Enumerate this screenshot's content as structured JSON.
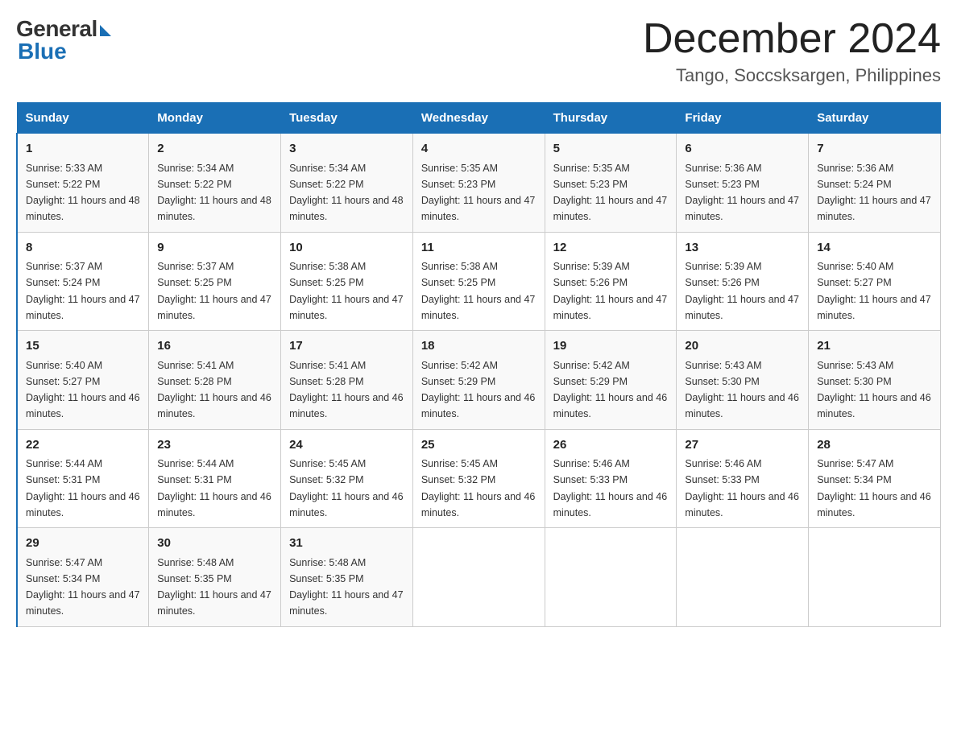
{
  "header": {
    "logo_general": "General",
    "logo_blue": "Blue",
    "month_title": "December 2024",
    "location": "Tango, Soccsksargen, Philippines"
  },
  "days_of_week": [
    "Sunday",
    "Monday",
    "Tuesday",
    "Wednesday",
    "Thursday",
    "Friday",
    "Saturday"
  ],
  "weeks": [
    [
      {
        "day": "1",
        "sunrise": "5:33 AM",
        "sunset": "5:22 PM",
        "daylight": "11 hours and 48 minutes."
      },
      {
        "day": "2",
        "sunrise": "5:34 AM",
        "sunset": "5:22 PM",
        "daylight": "11 hours and 48 minutes."
      },
      {
        "day": "3",
        "sunrise": "5:34 AM",
        "sunset": "5:22 PM",
        "daylight": "11 hours and 48 minutes."
      },
      {
        "day": "4",
        "sunrise": "5:35 AM",
        "sunset": "5:23 PM",
        "daylight": "11 hours and 47 minutes."
      },
      {
        "day": "5",
        "sunrise": "5:35 AM",
        "sunset": "5:23 PM",
        "daylight": "11 hours and 47 minutes."
      },
      {
        "day": "6",
        "sunrise": "5:36 AM",
        "sunset": "5:23 PM",
        "daylight": "11 hours and 47 minutes."
      },
      {
        "day": "7",
        "sunrise": "5:36 AM",
        "sunset": "5:24 PM",
        "daylight": "11 hours and 47 minutes."
      }
    ],
    [
      {
        "day": "8",
        "sunrise": "5:37 AM",
        "sunset": "5:24 PM",
        "daylight": "11 hours and 47 minutes."
      },
      {
        "day": "9",
        "sunrise": "5:37 AM",
        "sunset": "5:25 PM",
        "daylight": "11 hours and 47 minutes."
      },
      {
        "day": "10",
        "sunrise": "5:38 AM",
        "sunset": "5:25 PM",
        "daylight": "11 hours and 47 minutes."
      },
      {
        "day": "11",
        "sunrise": "5:38 AM",
        "sunset": "5:25 PM",
        "daylight": "11 hours and 47 minutes."
      },
      {
        "day": "12",
        "sunrise": "5:39 AM",
        "sunset": "5:26 PM",
        "daylight": "11 hours and 47 minutes."
      },
      {
        "day": "13",
        "sunrise": "5:39 AM",
        "sunset": "5:26 PM",
        "daylight": "11 hours and 47 minutes."
      },
      {
        "day": "14",
        "sunrise": "5:40 AM",
        "sunset": "5:27 PM",
        "daylight": "11 hours and 47 minutes."
      }
    ],
    [
      {
        "day": "15",
        "sunrise": "5:40 AM",
        "sunset": "5:27 PM",
        "daylight": "11 hours and 46 minutes."
      },
      {
        "day": "16",
        "sunrise": "5:41 AM",
        "sunset": "5:28 PM",
        "daylight": "11 hours and 46 minutes."
      },
      {
        "day": "17",
        "sunrise": "5:41 AM",
        "sunset": "5:28 PM",
        "daylight": "11 hours and 46 minutes."
      },
      {
        "day": "18",
        "sunrise": "5:42 AM",
        "sunset": "5:29 PM",
        "daylight": "11 hours and 46 minutes."
      },
      {
        "day": "19",
        "sunrise": "5:42 AM",
        "sunset": "5:29 PM",
        "daylight": "11 hours and 46 minutes."
      },
      {
        "day": "20",
        "sunrise": "5:43 AM",
        "sunset": "5:30 PM",
        "daylight": "11 hours and 46 minutes."
      },
      {
        "day": "21",
        "sunrise": "5:43 AM",
        "sunset": "5:30 PM",
        "daylight": "11 hours and 46 minutes."
      }
    ],
    [
      {
        "day": "22",
        "sunrise": "5:44 AM",
        "sunset": "5:31 PM",
        "daylight": "11 hours and 46 minutes."
      },
      {
        "day": "23",
        "sunrise": "5:44 AM",
        "sunset": "5:31 PM",
        "daylight": "11 hours and 46 minutes."
      },
      {
        "day": "24",
        "sunrise": "5:45 AM",
        "sunset": "5:32 PM",
        "daylight": "11 hours and 46 minutes."
      },
      {
        "day": "25",
        "sunrise": "5:45 AM",
        "sunset": "5:32 PM",
        "daylight": "11 hours and 46 minutes."
      },
      {
        "day": "26",
        "sunrise": "5:46 AM",
        "sunset": "5:33 PM",
        "daylight": "11 hours and 46 minutes."
      },
      {
        "day": "27",
        "sunrise": "5:46 AM",
        "sunset": "5:33 PM",
        "daylight": "11 hours and 46 minutes."
      },
      {
        "day": "28",
        "sunrise": "5:47 AM",
        "sunset": "5:34 PM",
        "daylight": "11 hours and 46 minutes."
      }
    ],
    [
      {
        "day": "29",
        "sunrise": "5:47 AM",
        "sunset": "5:34 PM",
        "daylight": "11 hours and 47 minutes."
      },
      {
        "day": "30",
        "sunrise": "5:48 AM",
        "sunset": "5:35 PM",
        "daylight": "11 hours and 47 minutes."
      },
      {
        "day": "31",
        "sunrise": "5:48 AM",
        "sunset": "5:35 PM",
        "daylight": "11 hours and 47 minutes."
      },
      null,
      null,
      null,
      null
    ]
  ]
}
